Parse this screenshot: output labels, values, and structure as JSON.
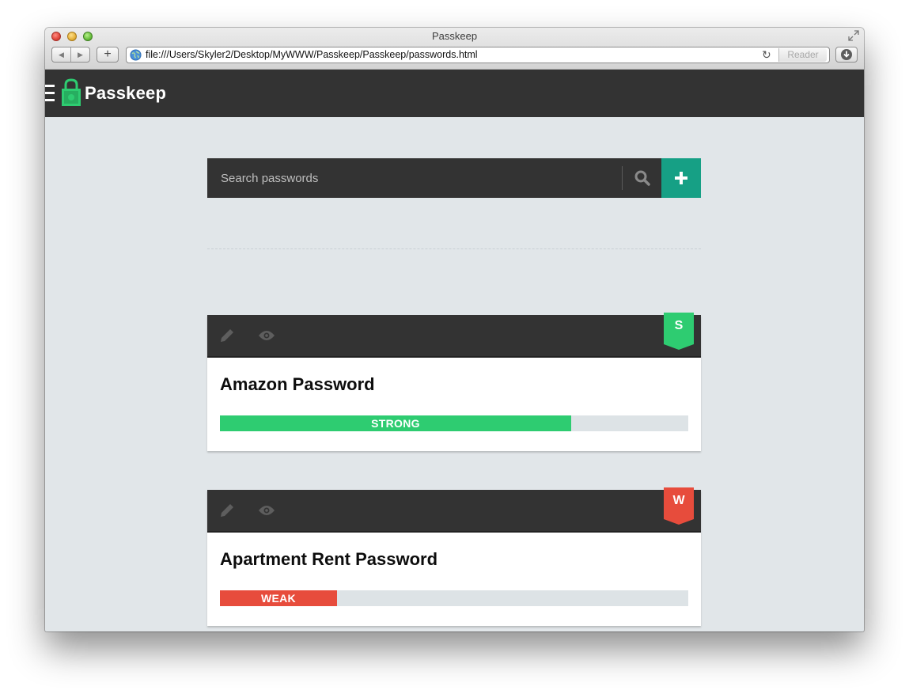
{
  "browser": {
    "window_title": "Passkeep",
    "url": "file:///Users/Skyler2/Desktop/MyWWW/Passkeep/Passkeep/passwords.html",
    "reader_label": "Reader",
    "add_tab_label": "+",
    "back_glyph": "◀",
    "forward_glyph": "▶",
    "reload_glyph": "↻"
  },
  "app": {
    "brand": "Passkeep"
  },
  "search": {
    "placeholder": "Search passwords"
  },
  "passwords": [
    {
      "title": "Amazon Password",
      "badge": "S",
      "strength_label": "STRONG",
      "strength": 0.75,
      "color": "#2ecc71"
    },
    {
      "title": "Apartment Rent Password",
      "badge": "W",
      "strength_label": "WEAK",
      "strength": 0.25,
      "color": "#e74c3c"
    }
  ],
  "colors": {
    "appbar": "#333333",
    "accent": "#16a085",
    "background": "#e1e6e9",
    "strong": "#2ecc71",
    "weak": "#e74c3c"
  }
}
